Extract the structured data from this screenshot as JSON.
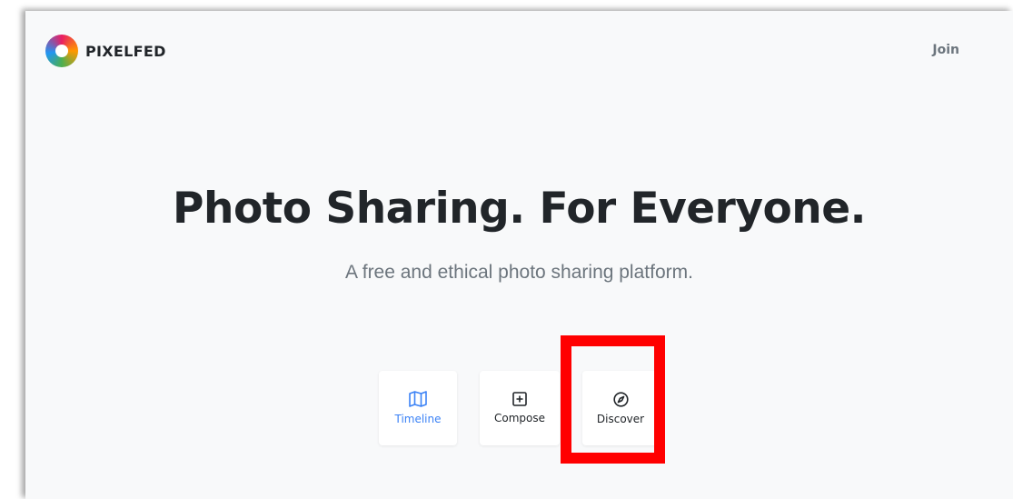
{
  "navbar": {
    "brand": "PIXELFED",
    "join_label": "Join"
  },
  "hero": {
    "title": "Photo Sharing. For Everyone.",
    "subtitle": "A free and ethical photo sharing platform."
  },
  "cards": [
    {
      "label": "Timeline",
      "icon": "map-icon",
      "active": true
    },
    {
      "label": "Compose",
      "icon": "plus-square-icon",
      "active": false
    },
    {
      "label": "Discover",
      "icon": "compass-icon",
      "active": false
    }
  ],
  "colors": {
    "accent": "#3b82f6",
    "highlight": "#ff0000",
    "background": "#f8f9fa"
  }
}
